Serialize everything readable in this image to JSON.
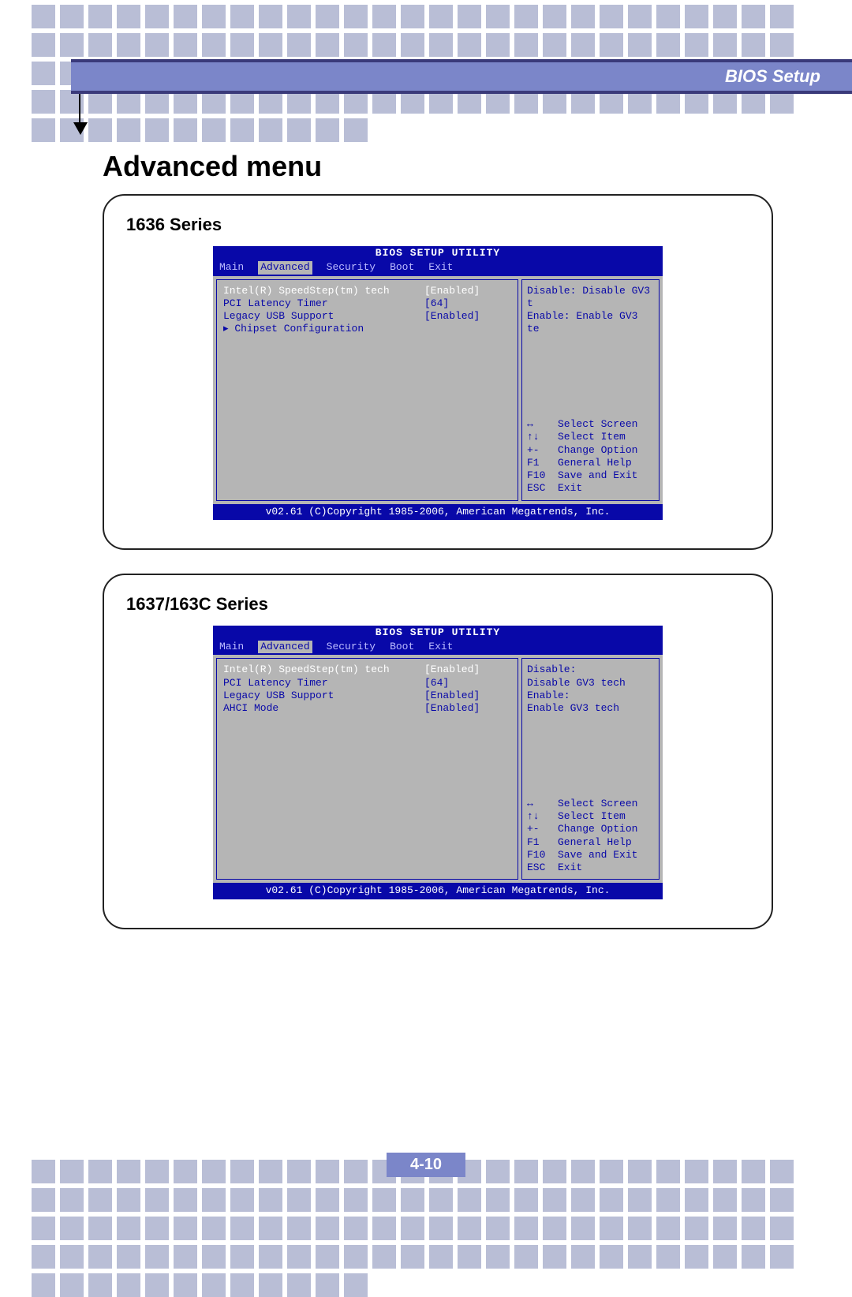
{
  "header": {
    "title": "BIOS Setup"
  },
  "page_title": "Advanced menu",
  "page_number": "4-10",
  "bios_common": {
    "utility_title": "BIOS SETUP UTILITY",
    "menu": [
      "Main",
      "Advanced",
      "Security",
      "Boot",
      "Exit"
    ],
    "active_menu": "Advanced",
    "footer": "v02.61 (C)Copyright 1985-2006, American Megatrends, Inc.",
    "keys": [
      {
        "k": "↔",
        "a": "Select Screen"
      },
      {
        "k": "↑↓",
        "a": "Select Item"
      },
      {
        "k": "+-",
        "a": "Change Option"
      },
      {
        "k": "F1",
        "a": "General Help"
      },
      {
        "k": "F10",
        "a": "Save and Exit"
      },
      {
        "k": "ESC",
        "a": "Exit"
      }
    ]
  },
  "panel1": {
    "title": "1636 Series",
    "items": [
      {
        "label": "Intel(R) SpeedStep(tm) tech",
        "value": "[Enabled]",
        "selected": true
      },
      {
        "label": "",
        "value": ""
      },
      {
        "label": "PCI Latency Timer",
        "value": "[64]"
      },
      {
        "label": "Legacy USB Support",
        "value": "[Enabled]"
      },
      {
        "label": "▸ Chipset Configuration",
        "value": ""
      }
    ],
    "help": [
      "Disable: Disable GV3 t",
      "Enable:  Enable GV3 te"
    ]
  },
  "panel2": {
    "title": "1637/163C Series",
    "items": [
      {
        "label": "Intel(R) SpeedStep(tm) tech",
        "value": "[Enabled]",
        "selected": true
      },
      {
        "label": "PCI Latency Timer",
        "value": "[64]"
      },
      {
        "label": "Legacy USB Support",
        "value": "[Enabled]"
      },
      {
        "label": "AHCI Mode",
        "value": "[Enabled]"
      }
    ],
    "help": [
      "Disable:",
      " Disable GV3 tech",
      "Enable:",
      " Enable GV3 tech"
    ]
  }
}
